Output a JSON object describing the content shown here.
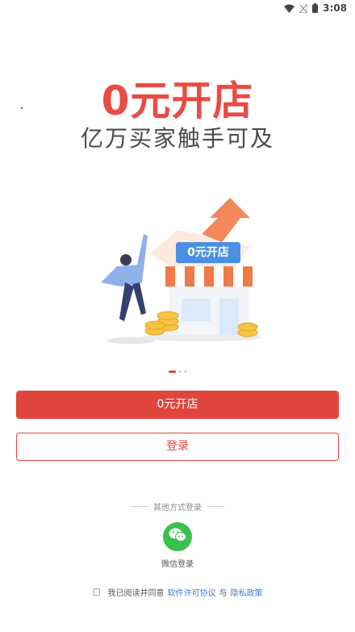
{
  "status_bar": {
    "time": "3:08"
  },
  "hero": {
    "title": "0元开店",
    "subtitle": "亿万买家触手可及"
  },
  "illustration": {
    "sign_text": "0元开店"
  },
  "pager": {
    "count": 3,
    "active": 0
  },
  "buttons": {
    "primary_label": "0元开店",
    "login_label": "登录"
  },
  "other_login": {
    "title": "其他方式登录",
    "wechat_label": "微信登录"
  },
  "agreement": {
    "checked": false,
    "prefix": "我已阅读并同意",
    "license_link": "软件许可协议",
    "and": "与",
    "privacy_link": "隐私政策"
  },
  "colors": {
    "accent": "#e0463d",
    "title_red": "#ea4b45",
    "wechat_green": "#39c14e",
    "link_blue": "#3d7bd6"
  }
}
